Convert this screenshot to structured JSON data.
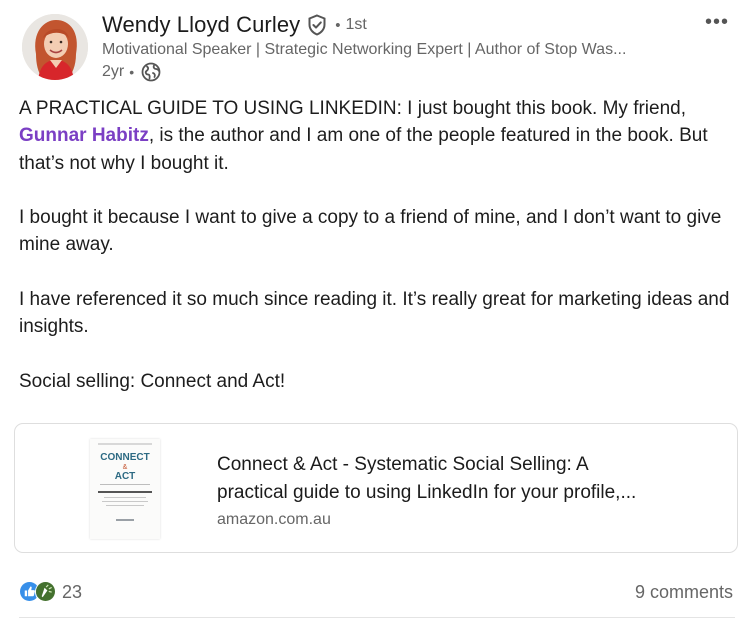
{
  "post": {
    "author": {
      "name": "Wendy Lloyd Curley",
      "verified_icon": "verified-shield-icon",
      "separator": "•",
      "degree": "1st",
      "headline": "Motivational Speaker | Strategic Networking Expert | Author of Stop Was...",
      "time_ago": "2yr",
      "meta_separator": "•",
      "visibility_icon": "globe-icon"
    },
    "more_icon": "•••",
    "body": {
      "p1_before": "A PRACTICAL GUIDE TO USING LINKEDIN: I just bought this book. My friend, ",
      "p1_mention": "Gunnar Habitz",
      "p1_after": ", is the author and I am one of the people featured in the book. But that’s not why I bought it.",
      "p2": "I bought it because I want to give a copy to a friend of mine, and I don’t want to give mine away.",
      "p3": "I have referenced it so much since reading it. It’s really great for marketing ideas and insights.",
      "p4": "Social selling: Connect and Act!"
    },
    "link_card": {
      "thumbnail": {
        "title_line1": "CONNECT",
        "title_line2": "&",
        "title_line3": "ACT"
      },
      "title_line1": "Connect & Act - Systematic Social Selling: A",
      "title_line2": "practical guide to using LinkedIn for your profile,...",
      "domain": "amazon.com.au"
    },
    "social": {
      "reaction_icons": [
        "like-icon",
        "celebrate-icon"
      ],
      "reaction_count": "23",
      "comments": "9 comments"
    },
    "colors": {
      "mention": "#7b3fc4",
      "like": "#378fe9",
      "celebrate": "#44712e",
      "secondary_text": "#666666"
    }
  }
}
